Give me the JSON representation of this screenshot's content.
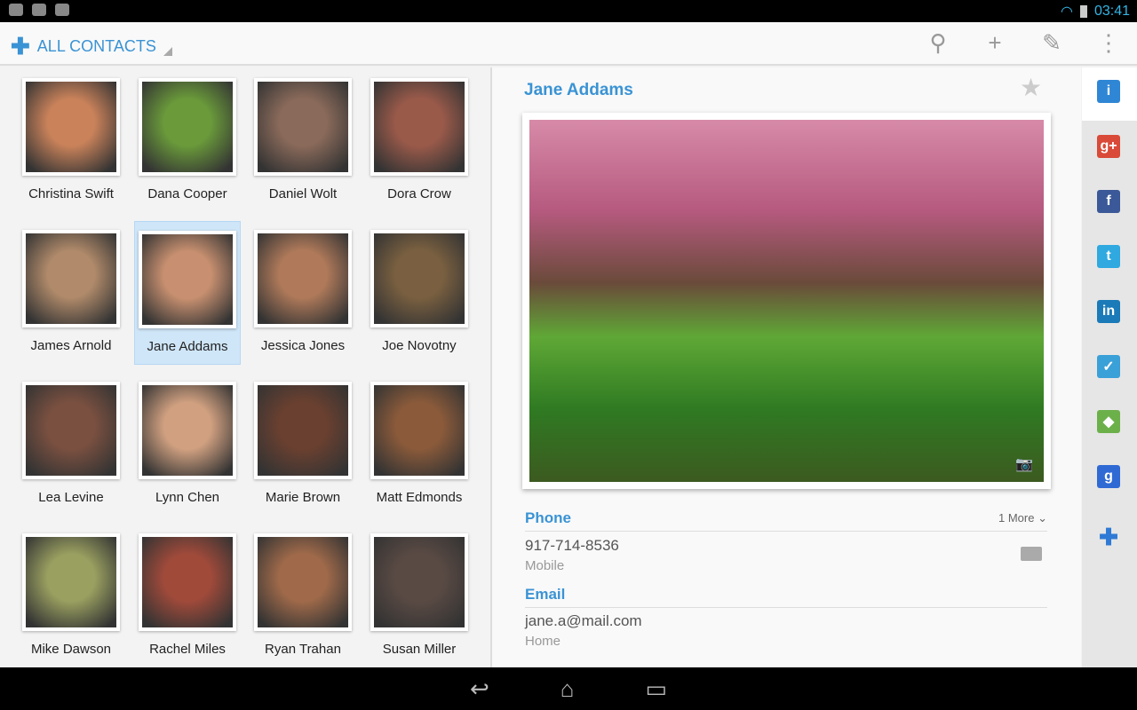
{
  "status": {
    "time": "03:41"
  },
  "action_bar": {
    "title": "ALL CONTACTS"
  },
  "contacts": [
    {
      "name": "Christina Swift",
      "color": "#c9825a"
    },
    {
      "name": "Dana Cooper",
      "color": "#6a9a3a"
    },
    {
      "name": "Daniel Wolt",
      "color": "#8a6a5a"
    },
    {
      "name": "Dora Crow",
      "color": "#9a5a4a"
    },
    {
      "name": "James Arnold",
      "color": "#b08a6a"
    },
    {
      "name": "Jane Addams",
      "color": "#c89070"
    },
    {
      "name": "Jessica Jones",
      "color": "#b07a5a"
    },
    {
      "name": "Joe Novotny",
      "color": "#7a6040"
    },
    {
      "name": "Lea Levine",
      "color": "#7a5040"
    },
    {
      "name": "Lynn Chen",
      "color": "#d0a080"
    },
    {
      "name": "Marie Brown",
      "color": "#6a4030"
    },
    {
      "name": "Matt Edmonds",
      "color": "#8a5a3a"
    },
    {
      "name": "Mike Dawson",
      "color": "#9aa060"
    },
    {
      "name": "Rachel Miles",
      "color": "#a04a3a"
    },
    {
      "name": "Ryan Trahan",
      "color": "#a06a4a"
    },
    {
      "name": "Susan Miller",
      "color": "#5a4a44"
    }
  ],
  "detail": {
    "name": "Jane Addams",
    "phone_header": "Phone",
    "more": "1 More",
    "phone": "917-714-8536",
    "phone_type": "Mobile",
    "email_header": "Email",
    "email": "jane.a@mail.com",
    "email_type": "Home"
  },
  "sidebar": [
    {
      "icon": "info-icon",
      "glyph": "i",
      "color": "#2f86d4"
    },
    {
      "icon": "google-plus-icon",
      "glyph": "g+",
      "color": "#d94a38"
    },
    {
      "icon": "facebook-icon",
      "glyph": "f",
      "color": "#3b5998"
    },
    {
      "icon": "twitter-icon",
      "glyph": "t",
      "color": "#2fa9e0"
    },
    {
      "icon": "linkedin-icon",
      "glyph": "in",
      "color": "#1b7ab8"
    },
    {
      "icon": "tasks-icon",
      "glyph": "✓",
      "color": "#3aa0d8"
    },
    {
      "icon": "maps-icon",
      "glyph": "◆",
      "color": "#6cb04a"
    },
    {
      "icon": "google-icon",
      "glyph": "g",
      "color": "#2f6ad4"
    }
  ]
}
